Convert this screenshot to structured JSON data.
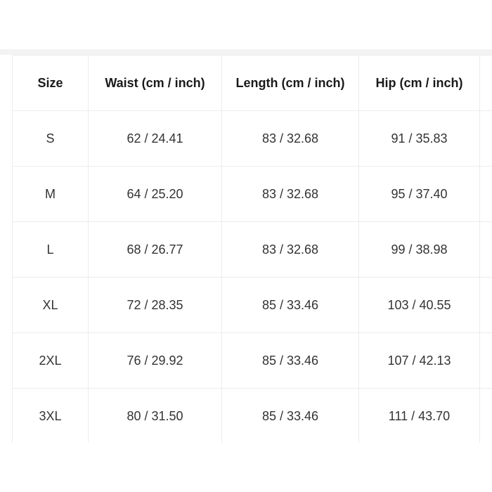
{
  "table": {
    "headers": [
      "Size",
      "Waist (cm / inch)",
      "Length (cm / inch)",
      "Hip (cm / inch)",
      ""
    ],
    "rows": [
      {
        "size": "S",
        "waist": "62 / 24.41",
        "length": "83 / 32.68",
        "hip": "91 / 35.83"
      },
      {
        "size": "M",
        "waist": "64 / 25.20",
        "length": "83 / 32.68",
        "hip": "95 / 37.40"
      },
      {
        "size": "L",
        "waist": "68 / 26.77",
        "length": "83 / 32.68",
        "hip": "99 / 38.98"
      },
      {
        "size": "XL",
        "waist": "72 / 28.35",
        "length": "85 / 33.46",
        "hip": "103 / 40.55"
      },
      {
        "size": "2XL",
        "waist": "76 / 29.92",
        "length": "85 / 33.46",
        "hip": "107 / 42.13"
      },
      {
        "size": "3XL",
        "waist": "80 / 31.50",
        "length": "85 / 33.46",
        "hip": "111 / 43.70"
      }
    ]
  }
}
